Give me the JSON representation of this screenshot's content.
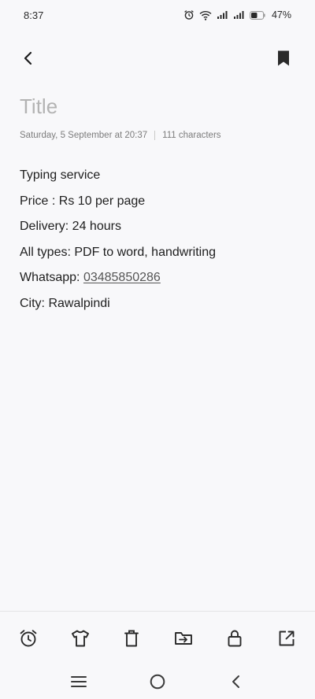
{
  "status_bar": {
    "time": "8:37",
    "battery_percent": "47%",
    "icons": [
      "alarm-icon",
      "wifi-icon",
      "signal-icon",
      "signal-icon",
      "battery-icon"
    ]
  },
  "app_bar": {
    "back_icon": "back-arrow-icon",
    "bookmark_icon": "bookmark-icon"
  },
  "note": {
    "title_placeholder": "Title",
    "date": "Saturday, 5 September at 20:37",
    "char_count": "111 characters",
    "lines": [
      "Typing service",
      "Price : Rs 10 per page",
      "Delivery: 24 hours",
      "All types: PDF to word, handwriting",
      "Whatsapp: ",
      "City: Rawalpindi"
    ],
    "phone": "03485850286"
  },
  "toolbar": {
    "icons": [
      "alarm-clock-icon",
      "shirt-icon",
      "trash-icon",
      "move-folder-icon",
      "lock-icon",
      "share-icon"
    ]
  },
  "nav_bar": {
    "icons": [
      "menu-icon",
      "home-icon",
      "back-icon"
    ]
  },
  "colors": {
    "background": "#f8f8fa",
    "text": "#1e1e1e",
    "muted": "#7c7c7c",
    "placeholder": "#b3b3b3"
  }
}
